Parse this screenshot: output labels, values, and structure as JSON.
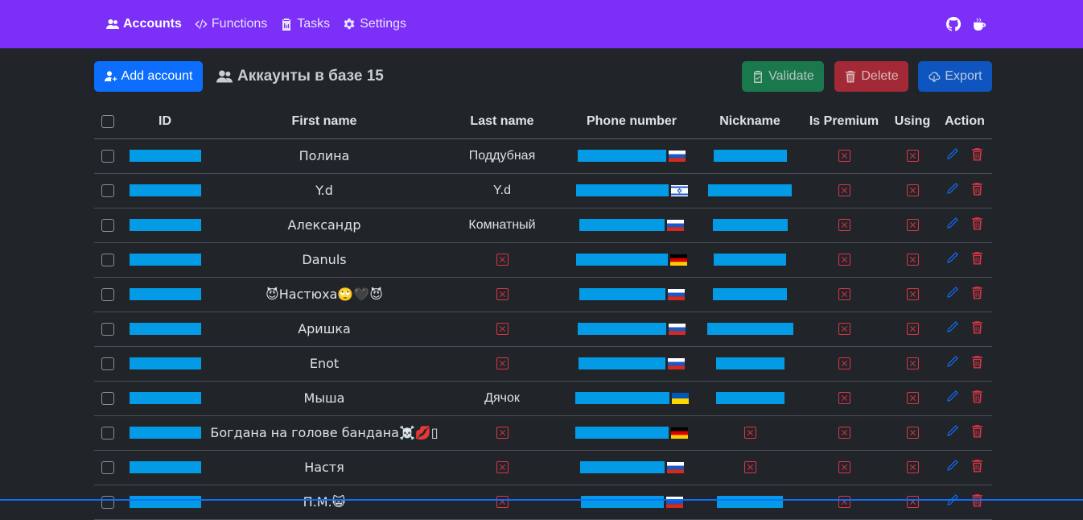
{
  "nav": {
    "items": [
      {
        "label": "Accounts",
        "icon": "users-icon",
        "active": true
      },
      {
        "label": "Functions",
        "icon": "code-icon",
        "active": false
      },
      {
        "label": "Tasks",
        "icon": "clipboard-icon",
        "active": false
      },
      {
        "label": "Settings",
        "icon": "gear-icon",
        "active": false
      }
    ],
    "right_icons": [
      "github-icon",
      "coffee-icon"
    ]
  },
  "toolbar": {
    "add_label": "Add account",
    "heading": "Аккаунты в базе 15",
    "validate_label": "Validate",
    "delete_label": "Delete",
    "export_label": "Export"
  },
  "table": {
    "headers": [
      "ID",
      "First name",
      "Last name",
      "Phone number",
      "Nickname",
      "Is Premium",
      "Using",
      "Action"
    ],
    "rows": [
      {
        "first_name": "Полина",
        "last_name": "Поддубная",
        "flag": "ru",
        "has_nickname": true
      },
      {
        "first_name": "Y.d",
        "last_name": "Y.d",
        "flag": "il",
        "has_nickname": true
      },
      {
        "first_name": "Александр",
        "last_name": "Комнатный",
        "flag": "ru",
        "has_nickname": true
      },
      {
        "first_name": "Danuls",
        "last_name": null,
        "flag": "de",
        "has_nickname": true
      },
      {
        "first_name": "😈Настюха🙄🖤😈",
        "last_name": null,
        "flag": "ru",
        "has_nickname": true
      },
      {
        "first_name": "Аришка",
        "last_name": null,
        "flag": "ru",
        "has_nickname": true
      },
      {
        "first_name": "Enot",
        "last_name": null,
        "flag": "ru",
        "has_nickname": true
      },
      {
        "first_name": "Мыша",
        "last_name": "Дячок",
        "flag": "ua",
        "has_nickname": true
      },
      {
        "first_name": "Богдана на голове бандана☠️💋▯",
        "last_name": null,
        "flag": "de",
        "has_nickname": false
      },
      {
        "first_name": "Настя",
        "last_name": null,
        "flag": "ru",
        "has_nickname": false
      },
      {
        "first_name": "П.М.😺",
        "last_name": null,
        "flag": "ru",
        "has_nickname": true
      }
    ]
  },
  "colors": {
    "navbar": "#7b2ff7",
    "background": "#212529",
    "redaction": "#039be5",
    "false_mark": "#dc3545",
    "edit": "#0d6efd"
  }
}
